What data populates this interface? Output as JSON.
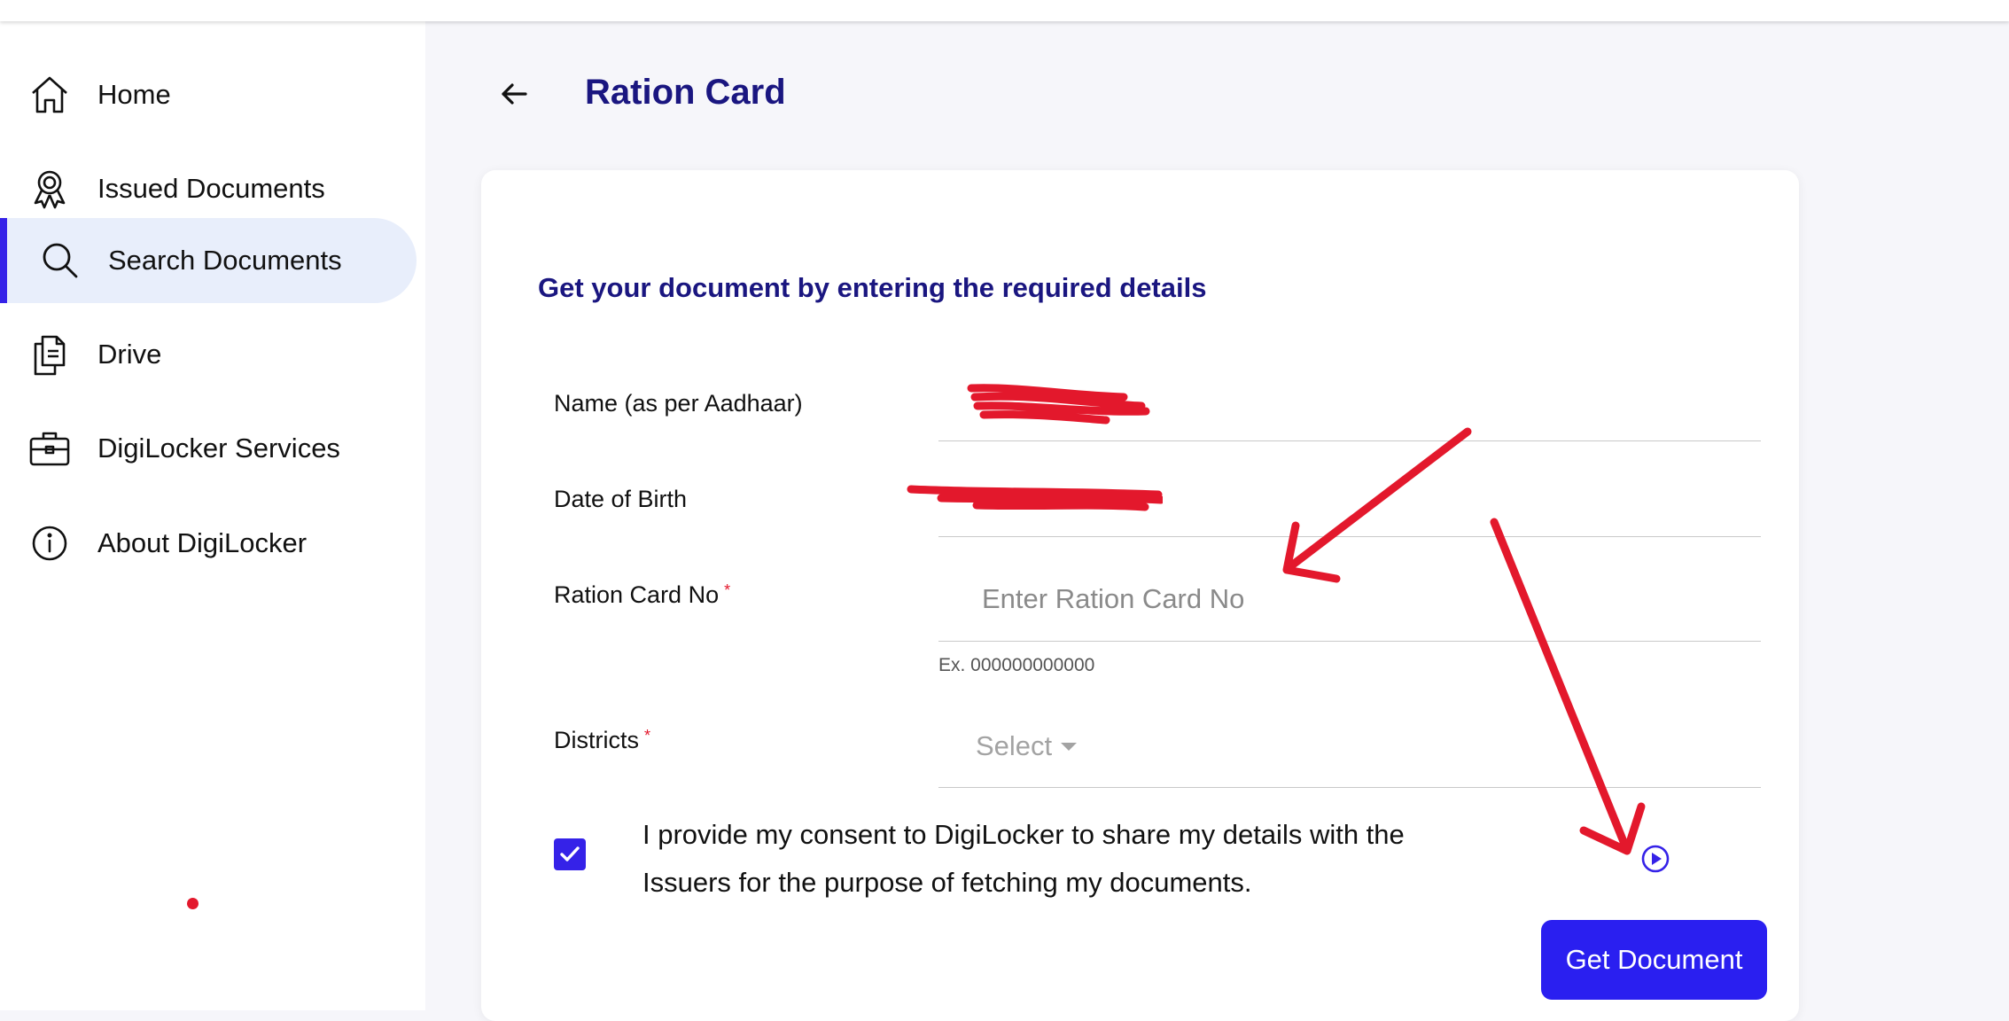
{
  "sidebar": {
    "items": [
      {
        "label": "Home",
        "icon": "home-icon"
      },
      {
        "label": "Issued Documents",
        "icon": "badge-icon"
      },
      {
        "label": "Search Documents",
        "icon": "search-icon"
      },
      {
        "label": "Drive",
        "icon": "files-icon"
      },
      {
        "label": "DigiLocker Services",
        "icon": "briefcase-icon"
      },
      {
        "label": "About DigiLocker",
        "icon": "info-icon"
      }
    ],
    "active_index": 2
  },
  "header": {
    "title": "Ration Card"
  },
  "form": {
    "heading": "Get your document by entering the required details",
    "name_label": "Name (as per Aadhaar)",
    "dob_label": "Date of Birth",
    "ration_label": "Ration Card No",
    "ration_placeholder": "Enter Ration Card No",
    "ration_hint": "Ex. 000000000000",
    "district_label": "Districts",
    "district_value": "Select",
    "required_mark": "*",
    "consent_checked": true,
    "consent_text": "I provide my consent to DigiLocker to share my details with the Issuers for the purpose of fetching my documents.",
    "submit_label": "Get Document"
  },
  "colors": {
    "accent": "#3522e8",
    "title": "#1a1680",
    "annotation_red": "#e3182c"
  }
}
